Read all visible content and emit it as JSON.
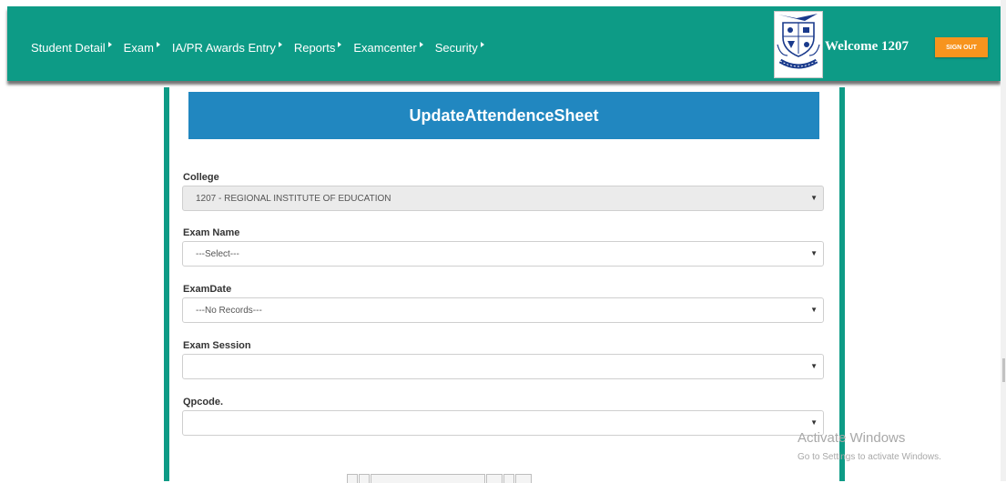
{
  "nav": {
    "items": [
      {
        "label": "Student Detail"
      },
      {
        "label": "Exam"
      },
      {
        "label": "IA/PR Awards Entry"
      },
      {
        "label": "Reports"
      },
      {
        "label": "Examcenter"
      },
      {
        "label": "Security"
      }
    ],
    "welcome": "Welcome 1207",
    "signout_label": "SIGN OUT"
  },
  "page": {
    "title": "UpdateAttendenceSheet"
  },
  "form": {
    "college": {
      "label": "College",
      "value": "1207 - REGIONAL INSTITUTE OF EDUCATION"
    },
    "exam_name": {
      "label": "Exam Name",
      "value": "---Select---"
    },
    "exam_date": {
      "label": "ExamDate",
      "value": "---No Records---"
    },
    "exam_session": {
      "label": "Exam Session",
      "value": ""
    },
    "qpcode": {
      "label": "Qpcode.",
      "value": ""
    }
  },
  "watermark": {
    "line1": "Activate Windows",
    "line2": "Go to Settings to activate Windows."
  },
  "colors": {
    "nav_bg": "#0d9b86",
    "title_bg": "#2187c0",
    "signout_bg": "#f7941d"
  }
}
